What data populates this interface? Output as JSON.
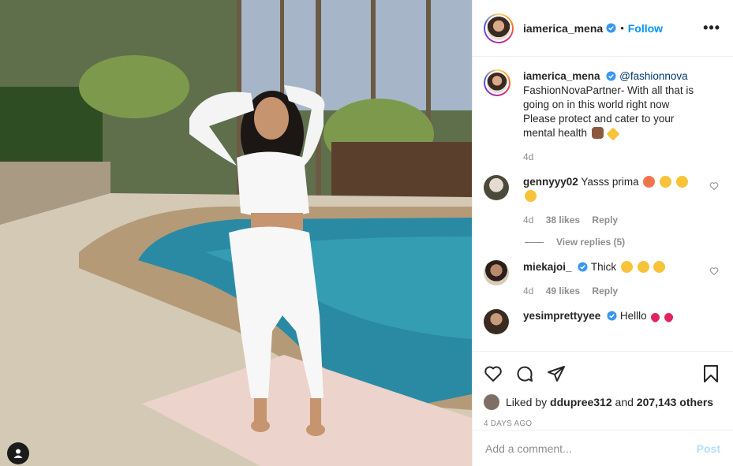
{
  "post": {
    "author": "iamerica_mena",
    "follow_label": "Follow",
    "dot": "•",
    "more_label": "•••"
  },
  "caption": {
    "username": "iamerica_mena",
    "mention": "@fashionnova",
    "text": "FashionNovaPartner- With all that is going on in this world right now Please protect and cater to your mental health",
    "time": "4d"
  },
  "comments": [
    {
      "username": "gennyyy02",
      "text": "Yasss prima",
      "time": "4d",
      "likes": "38 likes",
      "reply": "Reply",
      "view_replies": "View replies (5)"
    },
    {
      "username": "miekajoi_",
      "text": "Thick",
      "time": "4d",
      "likes": "49 likes",
      "reply": "Reply"
    },
    {
      "username": "yesimprettyyee",
      "text": "Helllo"
    }
  ],
  "actions": {
    "liked_by_prefix": "Liked by",
    "liked_by_user": "ddupree312",
    "and_label": "and",
    "others_count": "207,143 others",
    "time_ago": "4 DAYS AGO"
  },
  "add_comment": {
    "placeholder": "Add a comment...",
    "post_label": "Post"
  },
  "icons": [
    "user-tag-icon",
    "heart-icon",
    "comment-icon",
    "share-icon",
    "bookmark-icon",
    "verified-badge-icon",
    "more-icon"
  ],
  "colors": {
    "accent": "#0095f6",
    "post_disabled": "#b2dffc",
    "secondary_text": "#8e8e8e",
    "verified": "#3897f0"
  }
}
